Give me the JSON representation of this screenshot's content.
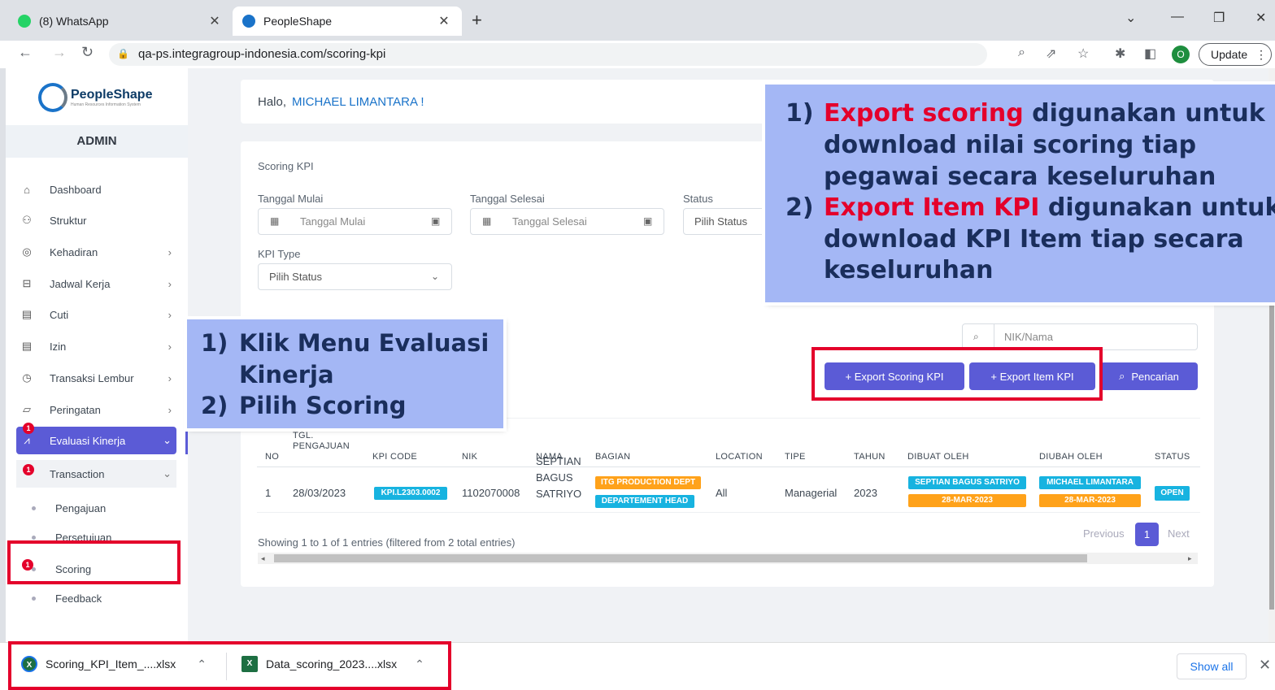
{
  "browser": {
    "tabs": [
      {
        "title": "(8) WhatsApp",
        "favicon_color": "#25d366",
        "badge": "8"
      },
      {
        "title": "PeopleShape",
        "favicon_color": "#1a73c9"
      }
    ],
    "url": "qa-ps.integragroup-indonesia.com/scoring-kpi",
    "profile_initial": "O",
    "update_label": "Update"
  },
  "sidebar": {
    "logo_name": "PeopleShape",
    "logo_sub": "Human Resources Information System",
    "role": "ADMIN",
    "items": [
      {
        "label": "Dashboard",
        "icon": "home-icon"
      },
      {
        "label": "Struktur",
        "icon": "org-icon"
      },
      {
        "label": "Kehadiran",
        "icon": "fingerprint-icon"
      },
      {
        "label": "Jadwal Kerja",
        "icon": "briefcase-icon"
      },
      {
        "label": "Cuti",
        "icon": "calendar-icon"
      },
      {
        "label": "Izin",
        "icon": "calendar-icon"
      },
      {
        "label": "Transaksi Lembur",
        "icon": "clock-icon"
      },
      {
        "label": "Peringatan",
        "icon": "warning-icon"
      },
      {
        "label": "Evaluasi Kinerja",
        "icon": "chart-icon"
      },
      {
        "label": "Transaction",
        "icon": "dot-icon"
      }
    ],
    "sub_items": [
      "Pengajuan",
      "Persetujuan",
      "Scoring",
      "Feedback"
    ],
    "badge": "1"
  },
  "greeting": {
    "prefix": "Halo, ",
    "name": "MICHAEL LIMANTARA !"
  },
  "form": {
    "section_title": "Scoring KPI",
    "start_label": "Tanggal Mulai",
    "start_placeholder": "Tanggal Mulai",
    "end_label": "Tanggal Selesai",
    "end_placeholder": "Tanggal Selesai",
    "status_label": "Status",
    "status_value": "Pilih Status",
    "kpi_type_label": "KPI Type",
    "kpi_type_value": "Pilih Status",
    "search_placeholder": "NIK/Nama"
  },
  "buttons": {
    "export_scoring": "+ Export Scoring KPI",
    "export_item": "+ Export Item KPI",
    "search": "Pencarian"
  },
  "table": {
    "headers": {
      "no": "NO",
      "tgl1": "TGL.",
      "tgl2": "PENGAJUAN",
      "kpi_code": "KPI CODE",
      "nik": "NIK",
      "nama": "NAMA",
      "bagian": "BAGIAN",
      "location": "LOCATION",
      "tipe": "TIPE",
      "tahun": "TAHUN",
      "dibuat": "DIBUAT OLEH",
      "diubah": "DIUBAH OLEH",
      "status": "STATUS"
    },
    "row": {
      "no": "1",
      "tgl": "28/03/2023",
      "kpi_code": "KPI.L2303.0002",
      "nik": "1102070008",
      "nama1": "SEPTIAN",
      "nama2": "BAGUS",
      "nama3": "SATRIYO",
      "bagian1": "ITG PRODUCTION DEPT",
      "bagian2": "DEPARTEMENT HEAD",
      "location": "All",
      "tipe": "Managerial",
      "tahun": "2023",
      "dibuat_name": "SEPTIAN BAGUS SATRIYO",
      "dibuat_date": "28-MAR-2023",
      "diubah_name": "MICHAEL LIMANTARA",
      "diubah_date": "28-MAR-2023",
      "status": "OPEN"
    },
    "info": "Showing 1 to 1 of 1 entries (filtered from 2 total entries)",
    "prev": "Previous",
    "page": "1",
    "next": "Next"
  },
  "annotations": {
    "right": {
      "n1": "1)",
      "l1_red": "Export scoring",
      "l1_rest": " digunakan untuk",
      "l2": "download nilai scoring tiap",
      "l3": "pegawai secara keseluruhan",
      "n2": "2)",
      "l4_red": "Export Item KPI",
      "l4_rest": " digunakan untuk",
      "l5": "download KPI Item tiap secara",
      "l6": "keseluruhan"
    },
    "left": {
      "n1": "1)",
      "l1": "Klik Menu Evaluasi",
      "l2": "Kinerja",
      "n2": "2)",
      "l3": "Pilih Scoring"
    }
  },
  "downloads": {
    "files": [
      "Scoring_KPI_Item_....xlsx",
      "Data_scoring_2023....xlsx"
    ],
    "show_all": "Show all"
  },
  "colors": {
    "accent": "#5b5bd6",
    "annotation_bg": "#a4b7f5",
    "highlight_red": "#e4002b",
    "pill_cyan": "#17b3e0",
    "pill_orange": "#ffa21a"
  }
}
